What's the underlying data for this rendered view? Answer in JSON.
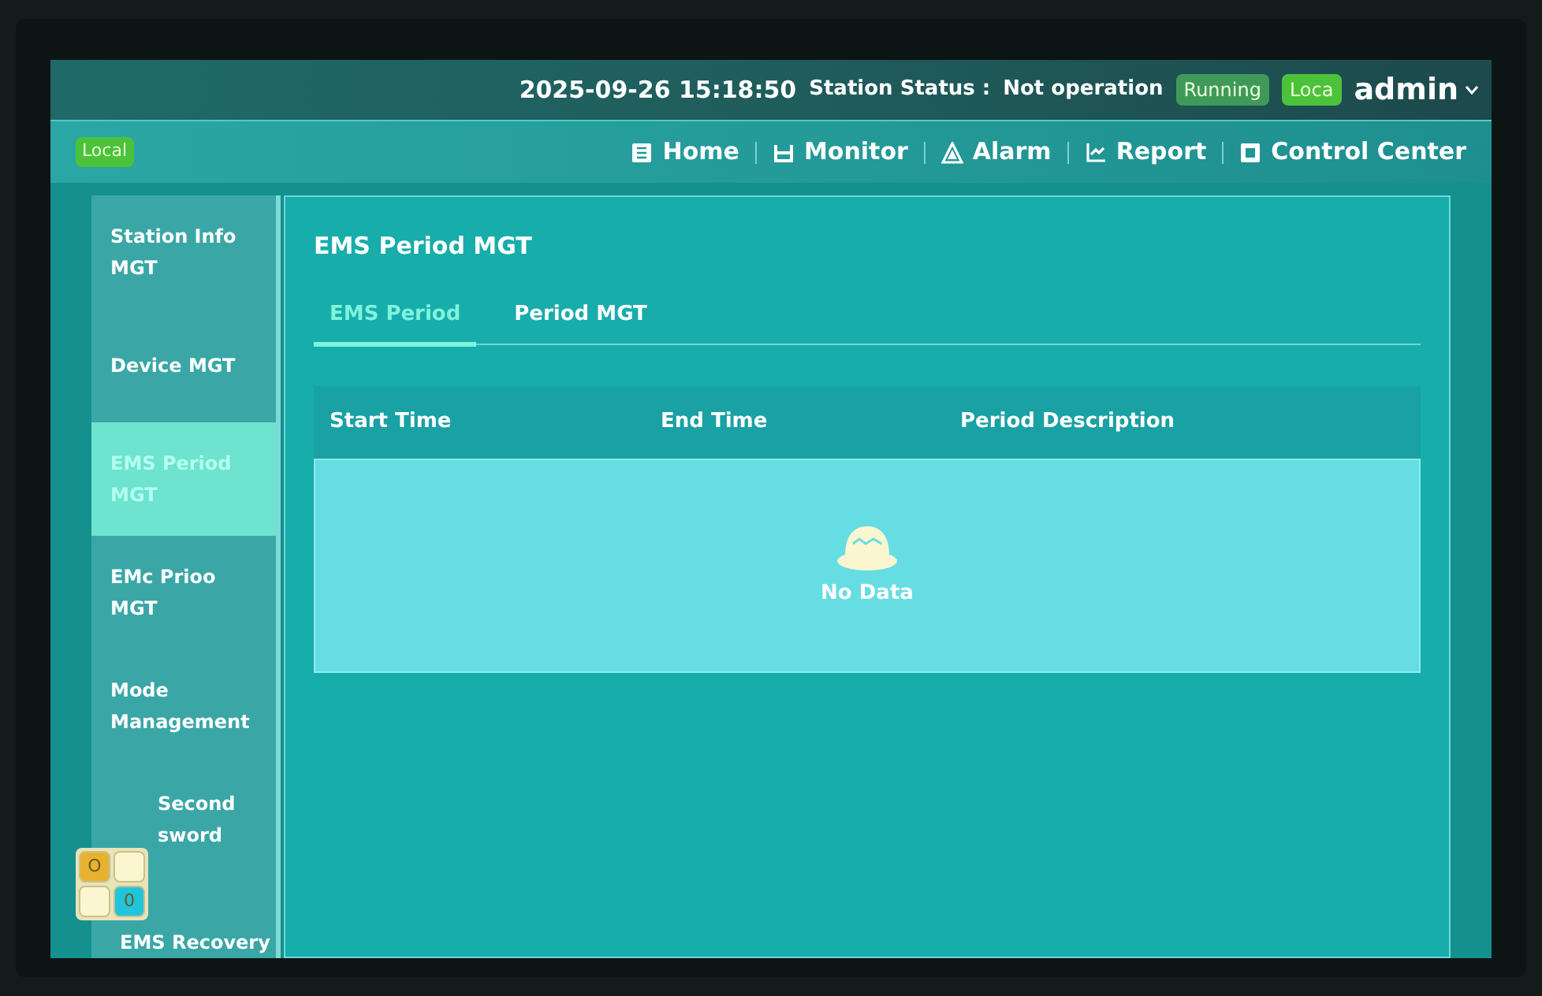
{
  "header": {
    "datetime": "2025-09-26 15:18:50",
    "status_label": "Station Status :",
    "status_value": "Not operation",
    "badges": [
      {
        "label": "Running",
        "color": "#3f9a5a"
      },
      {
        "label": "Loca",
        "color": "#4cc23a"
      }
    ],
    "user": "admin"
  },
  "nav": {
    "mode_badge": "Local",
    "items": [
      {
        "label": "Home",
        "kind": "home"
      },
      {
        "label": "Monitor",
        "kind": "monitor"
      },
      {
        "label": "Alarm",
        "kind": "alarm"
      },
      {
        "label": "Report",
        "kind": "report"
      },
      {
        "label": "Control Center",
        "kind": "control"
      }
    ]
  },
  "sidebar": {
    "items": [
      {
        "lines": [
          "Station Info",
          "MGT"
        ],
        "selected": false
      },
      {
        "lines": [
          "Device MGT"
        ],
        "selected": false
      },
      {
        "lines": [
          "EMS Period",
          "MGT"
        ],
        "selected": true
      },
      {
        "lines": [
          "EMc Prioo",
          "MGT"
        ],
        "selected": false
      },
      {
        "lines": [
          "Mode",
          "Management"
        ],
        "selected": false
      },
      {
        "lines": [
          "Second",
          "sword"
        ],
        "selected": false
      },
      {
        "lines": [
          "EMS Recovery"
        ],
        "selected": false
      }
    ]
  },
  "content": {
    "title": "EMS Period MGT",
    "tabs": [
      {
        "label": "EMS Period",
        "selected": true
      },
      {
        "label": "Period MGT",
        "selected": false
      }
    ],
    "table": {
      "columns": [
        "Start Time",
        "End Time",
        "Period Description"
      ],
      "empty_text": "No Data"
    }
  },
  "floating_widget": {
    "keys": [
      {
        "label": "O",
        "color": "#e8b230"
      },
      {
        "color": "#fbf6cf"
      },
      {
        "color": "#fbf6cf"
      },
      {
        "label": "0",
        "color": "#22c4dc"
      }
    ]
  }
}
